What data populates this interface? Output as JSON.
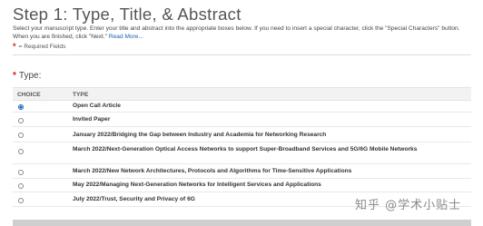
{
  "header": {
    "title": "Step 1: Type, Title, & Abstract",
    "instructions": "Select your manuscript type. Enter your title and abstract into the appropriate boxes below. If you need to insert a special character, click the \"Special Characters\" button. When you are finished, click \"Next.\"",
    "read_more": "Read More..."
  },
  "required": {
    "star": "*",
    "note": "= Required Fields"
  },
  "type_section": {
    "star": "*",
    "label": "Type:"
  },
  "table": {
    "columns": [
      "CHOICE",
      "TYPE"
    ],
    "rows": [
      {
        "label": "Open Call Article",
        "selected": true
      },
      {
        "label": "Invited Paper",
        "selected": false
      },
      {
        "label": "January 2022/Bridging the Gap between Industry and Academia for Networking Research",
        "selected": false
      },
      {
        "label": "March 2022/Next-Generation Optical Access Networks to support Super-Broadband Services and 5G/6G Mobile Networks",
        "selected": false
      },
      {
        "label": "March 2022/New Network Architectures, Protocols and Algorithms for Time-Sensitive Applications",
        "selected": false
      },
      {
        "label": "May 2022/Managing Next-Generation Networks for Intelligent Services and Applications",
        "selected": false
      },
      {
        "label": "July 2022/Trust, Security and Privacy of 6G",
        "selected": false
      }
    ]
  },
  "watermark": "知乎 @学术小贴士",
  "colors": {
    "accent": "#2166c3",
    "required": "#dd1111",
    "header_bg": "#f2f2f2"
  }
}
